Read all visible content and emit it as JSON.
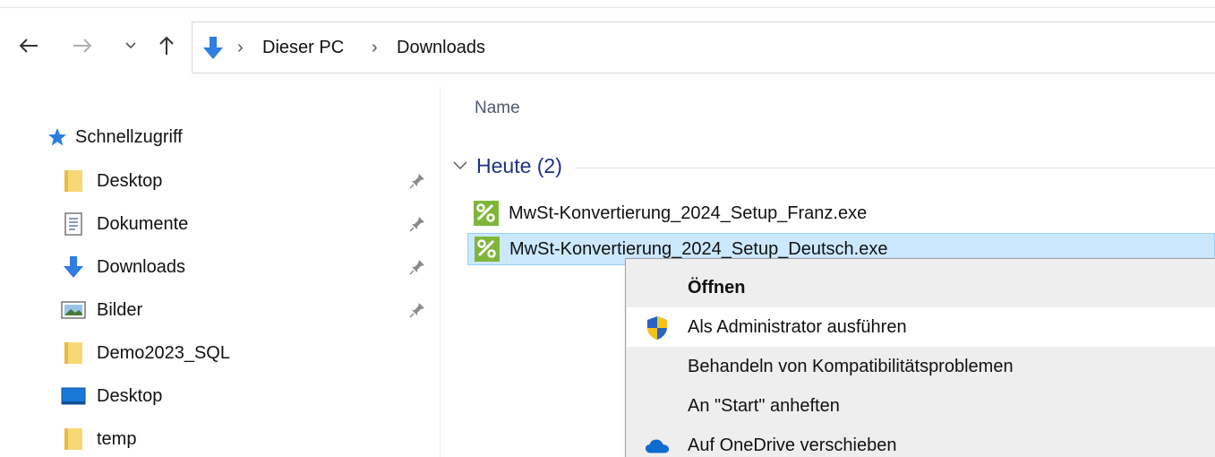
{
  "address_bar": {
    "breadcrumbs": [
      "Dieser PC",
      "Downloads"
    ],
    "separator": "›"
  },
  "nav_pane": {
    "quick_access_label": "Schnellzugriff",
    "items": [
      {
        "label": "Desktop",
        "icon": "folder-icon",
        "pinned": true
      },
      {
        "label": "Dokumente",
        "icon": "documents-icon",
        "pinned": true
      },
      {
        "label": "Downloads",
        "icon": "download-arrow-icon",
        "pinned": true
      },
      {
        "label": "Bilder",
        "icon": "pictures-icon",
        "pinned": true
      },
      {
        "label": "Demo2023_SQL",
        "icon": "folder-icon",
        "pinned": false
      },
      {
        "label": "Desktop",
        "icon": "desktop-icon",
        "pinned": false
      },
      {
        "label": "temp",
        "icon": "folder-icon",
        "pinned": false
      }
    ]
  },
  "file_list": {
    "column_name": "Name",
    "group_label": "Heute (2)",
    "files": [
      {
        "name": "MwSt-Konvertierung_2024_Setup_Franz.exe",
        "selected": false
      },
      {
        "name": "MwSt-Konvertierung_2024_Setup_Deutsch.exe",
        "selected": true
      }
    ]
  },
  "context_menu": {
    "items": [
      {
        "label": "Öffnen",
        "bold": true,
        "icon": ""
      },
      {
        "label": "Als Administrator ausführen",
        "bold": false,
        "icon": "uac-shield-icon",
        "hover": true
      },
      {
        "label": "Behandeln von Kompatibilitätsproblemen",
        "bold": false,
        "icon": ""
      },
      {
        "label": "An \"Start\" anheften",
        "bold": false,
        "icon": ""
      },
      {
        "label": "Auf OneDrive verschieben",
        "bold": false,
        "icon": "onedrive-cloud-icon"
      }
    ]
  },
  "colors": {
    "accent": "#1e3287",
    "selection": "#cce8ff",
    "selection_border": "#99d1ff",
    "menu_bg": "#eeeeee",
    "folder_yellow": "#f8d775",
    "download_blue": "#2f7ee0"
  }
}
